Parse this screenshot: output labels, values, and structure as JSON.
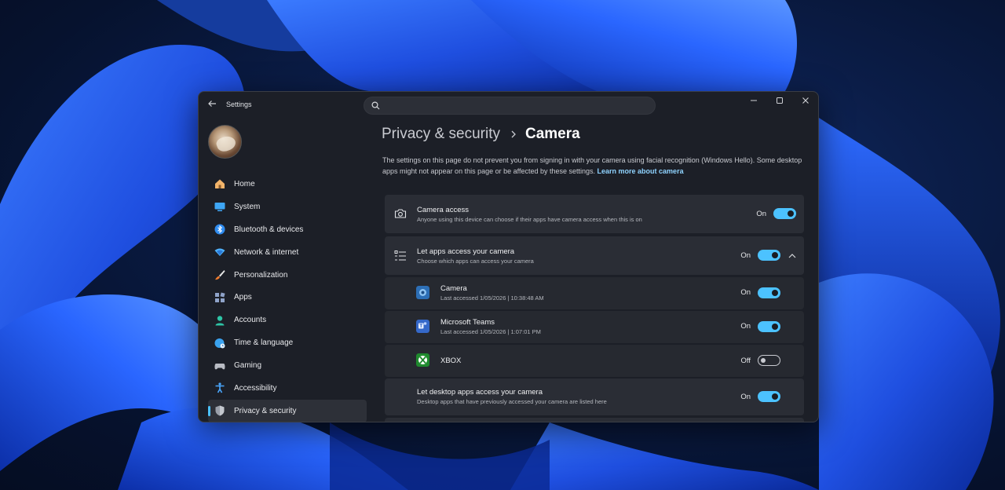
{
  "window": {
    "app_title": "Settings",
    "search_placeholder": ""
  },
  "sidebar": {
    "items": [
      {
        "label": "Home",
        "icon": "home-icon"
      },
      {
        "label": "System",
        "icon": "system-icon"
      },
      {
        "label": "Bluetooth & devices",
        "icon": "bluetooth-icon"
      },
      {
        "label": "Network & internet",
        "icon": "network-icon"
      },
      {
        "label": "Personalization",
        "icon": "brush-icon"
      },
      {
        "label": "Apps",
        "icon": "apps-icon"
      },
      {
        "label": "Accounts",
        "icon": "accounts-icon"
      },
      {
        "label": "Time & language",
        "icon": "globe-clock-icon"
      },
      {
        "label": "Gaming",
        "icon": "gamepad-icon"
      },
      {
        "label": "Accessibility",
        "icon": "accessibility-icon"
      },
      {
        "label": "Privacy & security",
        "icon": "shield-icon",
        "active": true
      }
    ]
  },
  "main": {
    "breadcrumb_parent": "Privacy & security",
    "breadcrumb_current": "Camera",
    "description": "The settings on this page do not prevent you from signing in with your camera using facial recognition (Windows Hello). Some desktop apps might not appear on this page or be affected by these settings.",
    "learn_more": "Learn more about camera",
    "camera_access": {
      "title": "Camera access",
      "subtitle": "Anyone using this device can choose if their apps have camera access when this is on",
      "state": "On"
    },
    "let_apps": {
      "title": "Let apps access your camera",
      "subtitle": "Choose which apps can access your camera",
      "state": "On"
    },
    "apps": [
      {
        "name": "Camera",
        "detail": "Last accessed 1/05/2026  |  10:38:48 AM",
        "state": "On",
        "icon": "camera-app-icon"
      },
      {
        "name": "Microsoft Teams",
        "detail": "Last accessed 1/05/2026  |  1:07:01 PM",
        "state": "On",
        "icon": "teams-icon"
      },
      {
        "name": "XBOX",
        "detail": "",
        "state": "Off",
        "icon": "xbox-icon"
      }
    ],
    "desktop_apps": {
      "title": "Let desktop apps access your camera",
      "subtitle": "Desktop apps that have previously accessed your camera are listed here",
      "state": "On"
    }
  },
  "colors": {
    "accent": "#4cc2ff",
    "window_bg": "#1c1f27",
    "card_bg": "#2a2d35"
  }
}
